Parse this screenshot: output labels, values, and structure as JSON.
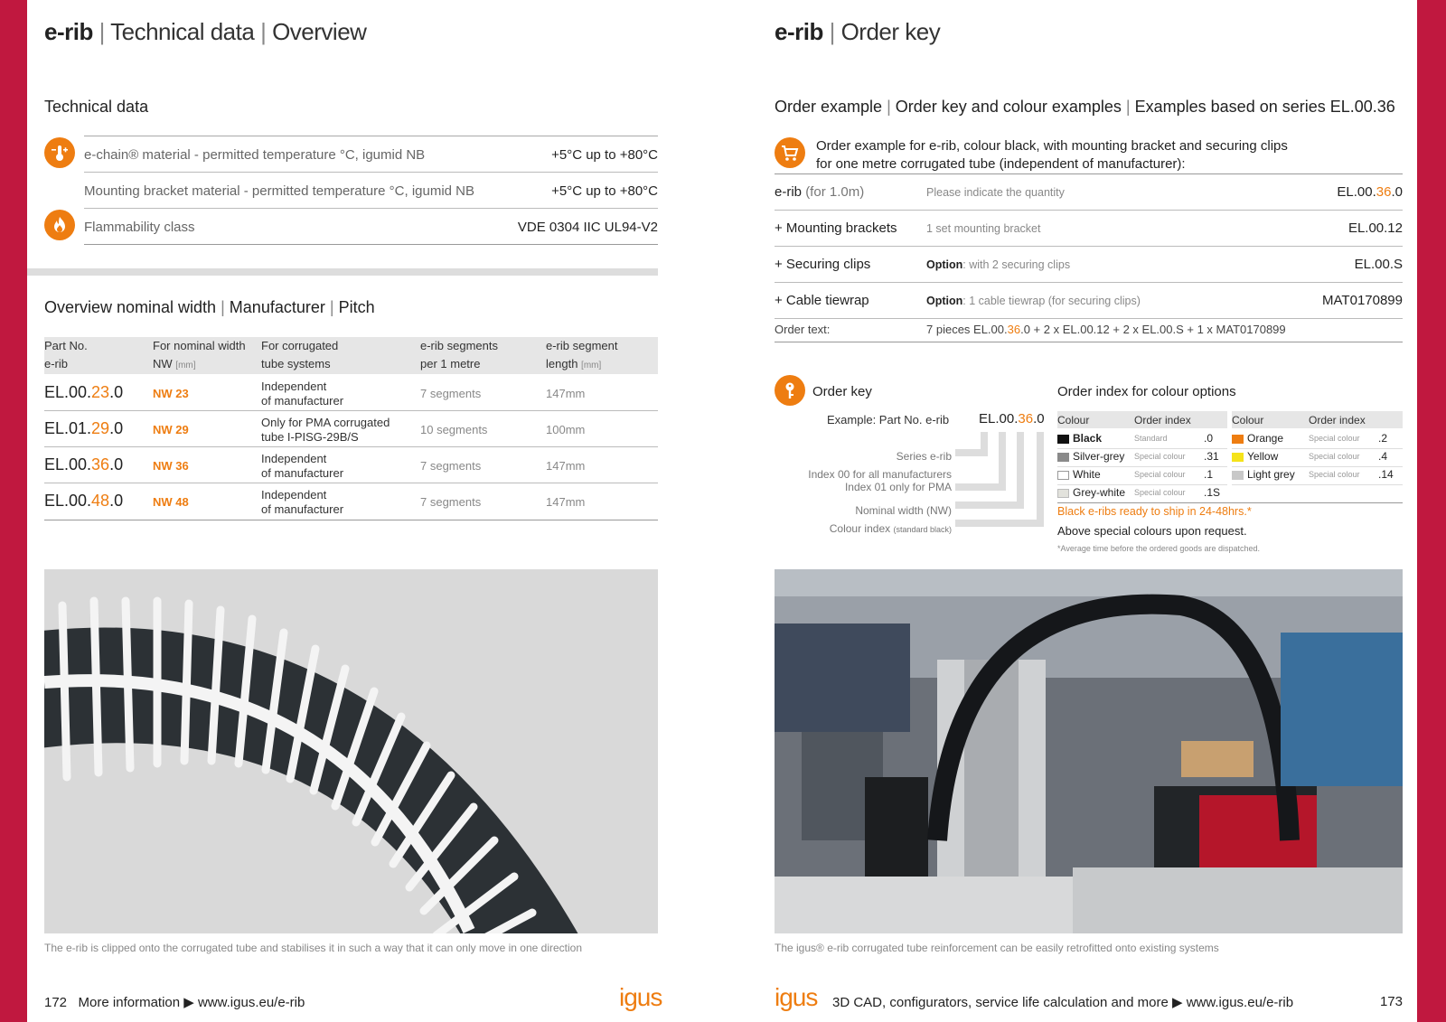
{
  "left": {
    "title_bold": "e-rib",
    "title_rest": "Technical data",
    "title_rest2": "Overview",
    "techdata": {
      "heading": "Technical data",
      "rows": [
        {
          "label": "e-chain® material - permitted temperature °C, igumid NB",
          "value": "+5°C up to +80°C"
        },
        {
          "label": "Mounting bracket material - permitted temperature °C, igumid NB",
          "value": "+5°C up to +80°C"
        },
        {
          "label": "Flammability class",
          "value": "VDE 0304 IIC UL94-V2"
        }
      ]
    },
    "overview": {
      "heading_a": "Overview nominal width",
      "heading_b": "Manufacturer",
      "heading_c": "Pitch",
      "headers": [
        {
          "l1": "Part No.",
          "l2": "e-rib",
          "unit": ""
        },
        {
          "l1": "For nominal width",
          "l2": "NW",
          "unit": "[mm]"
        },
        {
          "l1": "For corrugated",
          "l2": "tube systems",
          "unit": ""
        },
        {
          "l1": "e-rib segments",
          "l2": "per 1 metre",
          "unit": ""
        },
        {
          "l1": "e-rib segment",
          "l2": "length",
          "unit": "[mm]"
        }
      ],
      "rows": [
        {
          "p1": "EL.00.",
          "p2": "23",
          "p3": ".0",
          "nw": "NW 23",
          "tube1": "Independent",
          "tube2": "of manufacturer",
          "segments": "7 segments",
          "length": "147mm"
        },
        {
          "p1": "EL.01.",
          "p2": "29",
          "p3": ".0",
          "nw": "NW 29",
          "tube1": "Only for PMA corrugated",
          "tube2": "tube I-PISG-29B/S",
          "segments": "10 segments",
          "length": "100mm"
        },
        {
          "p1": "EL.00.",
          "p2": "36",
          "p3": ".0",
          "nw": "NW 36",
          "tube1": "Independent",
          "tube2": "of manufacturer",
          "segments": "7 segments",
          "length": "147mm"
        },
        {
          "p1": "EL.00.",
          "p2": "48",
          "p3": ".0",
          "nw": "NW 48",
          "tube1": "Independent",
          "tube2": "of manufacturer",
          "segments": "7 segments",
          "length": "147mm"
        }
      ]
    },
    "caption": "The e-rib is clipped onto the corrugated tube and stabilises it in such a way that it can only move in one direction",
    "footer": {
      "page": "172",
      "text": "More information ▶ www.igus.eu/e-rib",
      "logo": "igus"
    }
  },
  "right": {
    "title_bold": "e-rib",
    "title_rest": "Order key",
    "order_example": {
      "heading_a": "Order example",
      "heading_b": "Order key and colour examples",
      "heading_c": "Examples based on series EL.00.36",
      "intro1": "Order example for e-rib, colour black, with mounting bracket and securing clips",
      "intro2": "for one metre corrugated tube (independent of manufacturer):",
      "rows": [
        {
          "left": "e-rib",
          "left_note": "(for 1.0m)",
          "mid_bold": "",
          "mid": "Please indicate the quantity",
          "r1": "EL.00.",
          "r2": "36",
          "r3": ".0"
        },
        {
          "left": "+ Mounting brackets",
          "left_note": "",
          "mid_bold": "",
          "mid": "1 set mounting bracket",
          "r1": "EL.00.12",
          "r2": "",
          "r3": ""
        },
        {
          "left": "+ Securing clips",
          "left_note": "",
          "mid_bold": "Option",
          "mid": ": with 2 securing clips",
          "r1": "EL.00.S",
          "r2": "",
          "r3": ""
        },
        {
          "left": "+ Cable tiewrap",
          "left_note": "",
          "mid_bold": "Option",
          "mid": ": 1 cable tiewrap (for securing clips)",
          "r1": "MAT0170899",
          "r2": "",
          "r3": ""
        }
      ],
      "order_text_label": "Order text:",
      "order_text_a": "7 pieces EL.00.",
      "order_text_b": "36",
      "order_text_c": ".0 + 2 x EL.00.12 + 2 x EL.00.S + 1 x MAT0170899"
    },
    "order_key": {
      "heading": "Order key",
      "example_label": "Example: Part No. e-rib",
      "ex1": "EL.00.",
      "ex2": "36",
      "ex3": ".0",
      "labels": [
        {
          "text": "Series e-rib",
          "small": ""
        },
        {
          "text": "Index 00 for all manufacturers",
          "small": ""
        },
        {
          "text": "Index 01 only for PMA",
          "small": ""
        },
        {
          "text": "Nominal width (NW)",
          "small": ""
        },
        {
          "text": "Colour index",
          "small": "(standard black)"
        }
      ]
    },
    "colours": {
      "heading": "Order index for colour options",
      "h_colour": "Colour",
      "h_index": "Order index",
      "left": [
        {
          "name": "Black",
          "type": "Standard",
          "idx": ".0",
          "color": "#111111"
        },
        {
          "name": "Silver-grey",
          "type": "Special colour",
          "idx": ".31",
          "color": "#8a8a8a"
        },
        {
          "name": "White",
          "type": "Special colour",
          "idx": ".1",
          "color": "#ffffff"
        },
        {
          "name": "Grey-white",
          "type": "Special colour",
          "idx": ".1S",
          "color": "#e2e2dc"
        }
      ],
      "right": [
        {
          "name": "Orange",
          "type": "Special colour",
          "idx": ".2",
          "color": "#ee7d11"
        },
        {
          "name": "Yellow",
          "type": "Special colour",
          "idx": ".4",
          "color": "#f5e31a"
        },
        {
          "name": "Light grey",
          "type": "Special colour",
          "idx": ".14",
          "color": "#c8c8c8"
        }
      ],
      "ship": "Black e-ribs ready to ship in 24-48hrs.*",
      "special": "Above special colours upon request.",
      "footnote": "*Average time before the ordered goods are dispatched."
    },
    "caption": "The igus® e-rib corrugated tube reinforcement can be easily retrofitted onto existing systems",
    "footer": {
      "page": "173",
      "text": "3D CAD, configurators, service life calculation and more ▶ www.igus.eu/e-rib",
      "logo": "igus"
    }
  }
}
